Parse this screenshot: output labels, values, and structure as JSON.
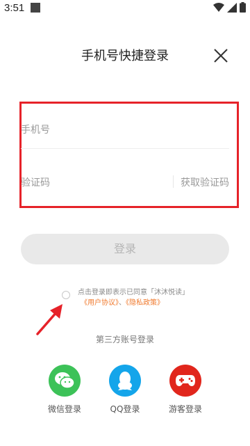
{
  "status_bar": {
    "time": "3:51"
  },
  "header": {
    "title": "手机号快捷登录"
  },
  "form": {
    "phone_placeholder": "手机号",
    "code_placeholder": "验证码",
    "get_code_label": "获取验证码"
  },
  "login_button": {
    "label": "登录"
  },
  "agreement": {
    "line1": "点击登录即表示已同意「沐沐悦读」",
    "user_agreement": "《用户协议》",
    "separator": "、",
    "privacy_policy": "《隐私政策》"
  },
  "third_party": {
    "title": "第三方账号登录",
    "items": [
      {
        "label": "微信登录",
        "icon": "wechat-icon",
        "color": "#3cc258"
      },
      {
        "label": "QQ登录",
        "icon": "qq-icon",
        "color": "#14a5ea"
      },
      {
        "label": "游客登录",
        "icon": "gamepad-icon",
        "color": "#e1261c"
      }
    ]
  },
  "colors": {
    "highlight_border": "#e62229",
    "link": "#f07a2e",
    "button_bg": "#e9e9e9"
  }
}
